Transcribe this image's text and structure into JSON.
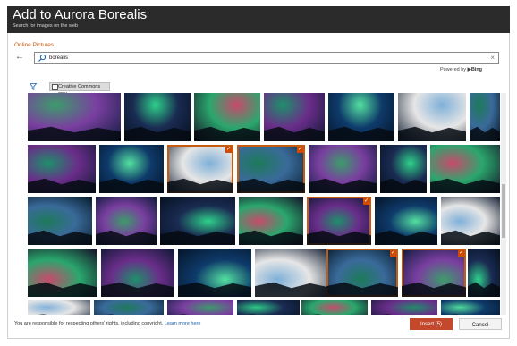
{
  "dialog": {
    "title": "Add to Aurora Borealis",
    "subtitle": "Search for images on the web"
  },
  "section": {
    "title": "Online Pictures"
  },
  "search": {
    "value": "borealis",
    "clear_label": "×",
    "back_label": "←"
  },
  "powered": {
    "prefix": "Powered by",
    "brand": "Bing"
  },
  "filter": {
    "creative_commons_label": "Creative Commons only"
  },
  "footer": {
    "notice": "You are responsible for respecting others' rights, including copyright.",
    "link": "Learn more here"
  },
  "buttons": {
    "insert_label": "Insert (5)",
    "cancel_label": "Cancel"
  },
  "colors": {
    "accent": "#c55a11",
    "insert": "#c3482c",
    "title_bar": "#2b2b2b",
    "link": "#1b5faa"
  },
  "results": {
    "rows": [
      [
        {
          "sel": false
        },
        {
          "sel": false
        },
        {
          "sel": false
        },
        {
          "sel": false
        },
        {
          "sel": false
        },
        {
          "sel": false
        },
        {
          "sel": false
        }
      ],
      [
        {
          "sel": false
        },
        {
          "sel": false
        },
        {
          "sel": true
        },
        {
          "sel": true
        },
        {
          "sel": false
        },
        {
          "sel": false
        },
        {
          "sel": false
        }
      ],
      [
        {
          "sel": false
        },
        {
          "sel": false
        },
        {
          "sel": false
        },
        {
          "sel": false
        },
        {
          "sel": true
        },
        {
          "sel": false
        },
        {
          "sel": false
        }
      ],
      [
        {
          "sel": false
        },
        {
          "sel": false
        },
        {
          "sel": false
        },
        {
          "sel": false
        },
        {
          "sel": true
        },
        {
          "sel": true
        },
        {
          "sel": false
        }
      ],
      [
        {
          "sel": false
        },
        {
          "sel": false
        },
        {
          "sel": false
        },
        {
          "sel": false
        },
        {
          "sel": false
        },
        {
          "sel": false
        },
        {
          "sel": false
        }
      ]
    ]
  }
}
